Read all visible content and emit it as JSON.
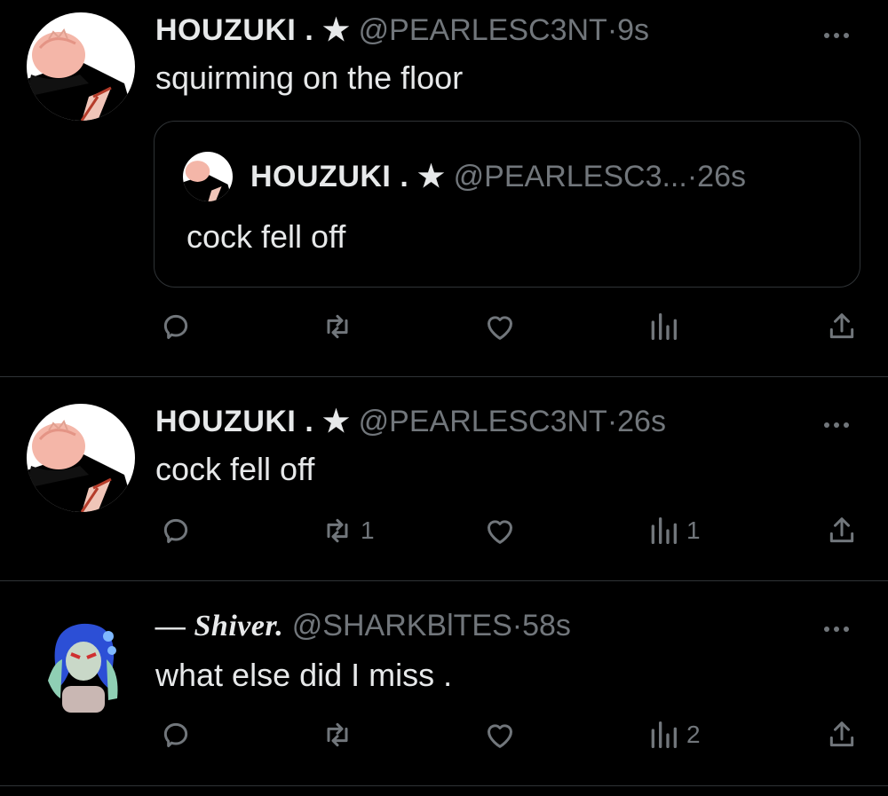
{
  "tweets": [
    {
      "name": "HOUZUKI . ★",
      "handle": "@PEARLESC3NT",
      "sep": "·",
      "time": "9s",
      "text": "squirming on the floor",
      "quote": {
        "name": "HOUZUKI . ★",
        "handle": "@PEARLESC3...",
        "sep": "·",
        "time": "26s",
        "text": "cock fell off"
      },
      "retweets": "",
      "views": ""
    },
    {
      "name": "HOUZUKI . ★",
      "handle": "@PEARLESC3NT",
      "sep": "·",
      "time": "26s",
      "text": "cock fell off",
      "retweets": "1",
      "views": "1"
    },
    {
      "name": "— Shiver.",
      "handle": "@SHARKBlTES",
      "sep": "·",
      "time": "58s",
      "text": "what else did I miss .",
      "retweets": "",
      "views": "2"
    }
  ],
  "icons": {
    "reply": "reply-icon",
    "retweet": "retweet-icon",
    "like": "heart-icon",
    "views": "views-icon",
    "share": "share-icon",
    "more": "more-icon"
  },
  "colors": {
    "background": "#000000",
    "text": "#e7e9ea",
    "muted": "#71767b",
    "divider": "#2f3336"
  }
}
